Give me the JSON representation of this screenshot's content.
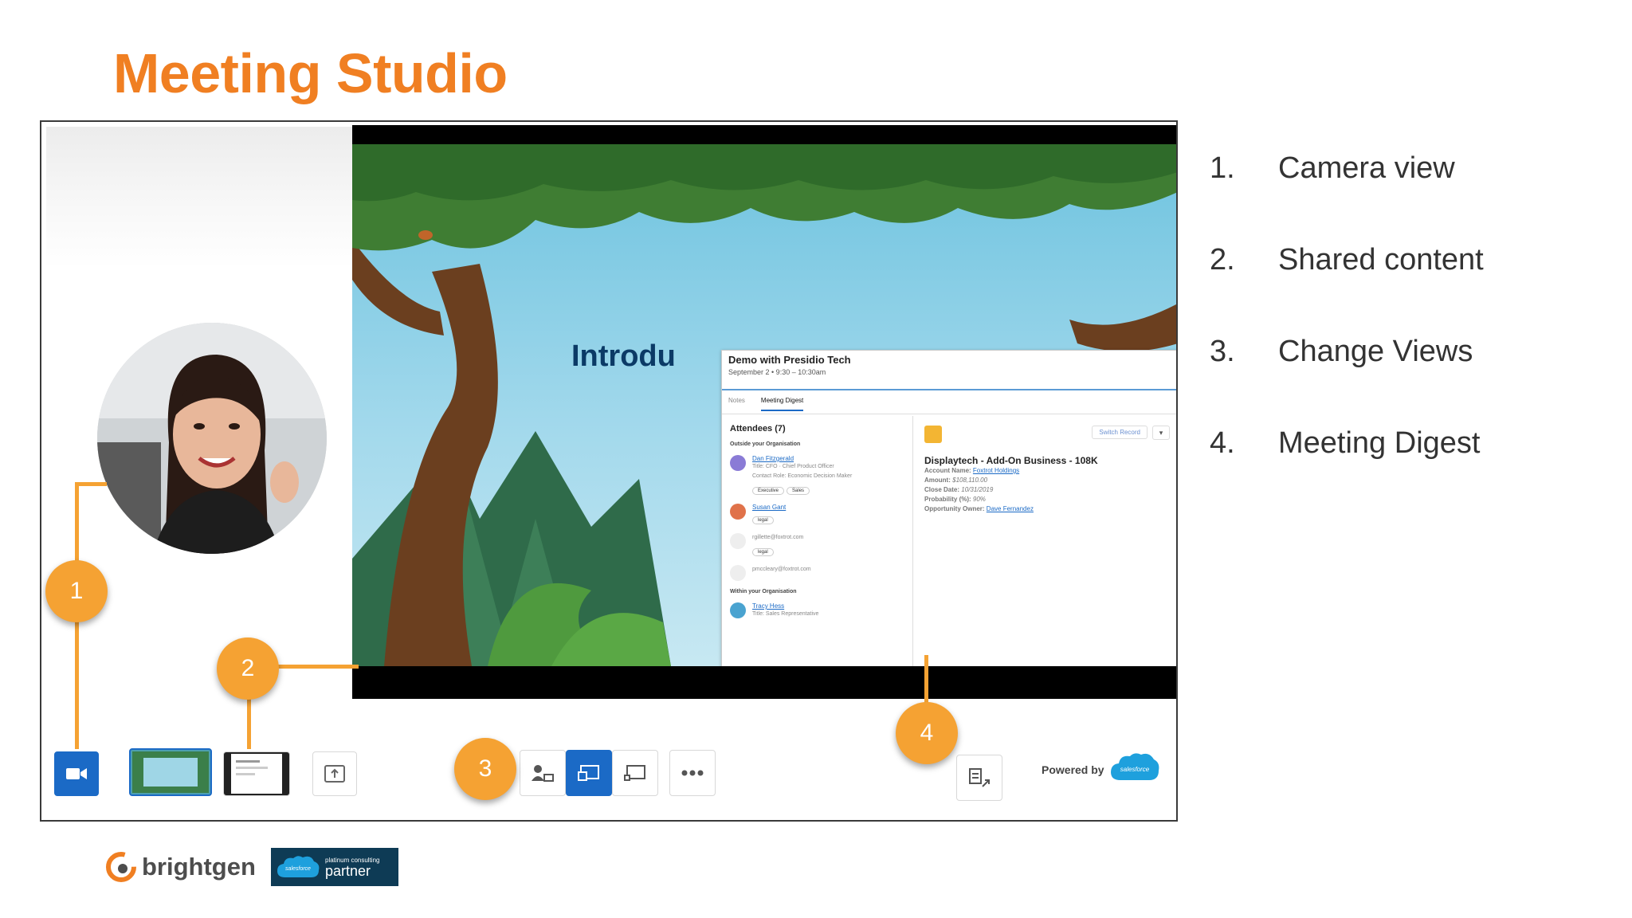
{
  "slide": {
    "title": "Meeting Studio"
  },
  "popup": {
    "title": "Demo with Presidio Tech",
    "subtitle": "September 2 • 9:30 – 10:30am",
    "tabs": [
      "Notes",
      "Meeting Digest"
    ],
    "attendees_title": "Attendees (7)",
    "outside_group": "Outside your Organisation",
    "within_group": "Within your Organisation",
    "attendees": [
      {
        "name": "Dan Fitzgerald",
        "meta": [
          "Title: CFO · Chief Product Officer",
          "Contact Role: Economic Decision Maker"
        ],
        "chips": [
          "Executive",
          "Sales"
        ]
      },
      {
        "name": "Susan Gant",
        "meta": [],
        "chips": [
          "legal"
        ]
      },
      {
        "name": "rgillette@foxtrot.com",
        "meta": [],
        "chips": [
          "legal"
        ]
      },
      {
        "name": "pmccleary@foxtrot.com",
        "meta": [],
        "chips": []
      }
    ],
    "internal_attendee": {
      "name": "Tracy Hess",
      "meta": "Title: Sales Representative"
    },
    "switch_record": "Switch Record",
    "record": {
      "title": "Displaytech - Add-On Business - 108K",
      "fields": [
        {
          "label": "Account Name:",
          "value": "Foxtrot Holdings"
        },
        {
          "label": "Amount:",
          "value": "$108,110.00"
        },
        {
          "label": "Close Date:",
          "value": "10/31/2019"
        },
        {
          "label": "Probability (%):",
          "value": "90%"
        },
        {
          "label": "Opportunity Owner:",
          "value": "Dave Fernandez"
        }
      ]
    }
  },
  "shared_content": {
    "slide_text": "Introdu"
  },
  "toolbar": {
    "powered_by": "Powered by",
    "salesforce": "salesforce"
  },
  "callouts": [
    "1",
    "2",
    "3",
    "4"
  ],
  "legend": [
    {
      "num": "1.",
      "label": "Camera view"
    },
    {
      "num": "2.",
      "label": "Shared content"
    },
    {
      "num": "3.",
      "label": "Change Views"
    },
    {
      "num": "4.",
      "label": "Meeting Digest"
    }
  ],
  "footer": {
    "brightgen": "brightgen",
    "partner_small_1": "platinum consulting",
    "partner_big": "partner",
    "partner_sf": "salesforce"
  },
  "colors": {
    "orange_title": "#f07f22",
    "callout": "#f5a233",
    "toolbar_blue": "#1b6ac6",
    "partner_bg": "#0e3b55"
  }
}
